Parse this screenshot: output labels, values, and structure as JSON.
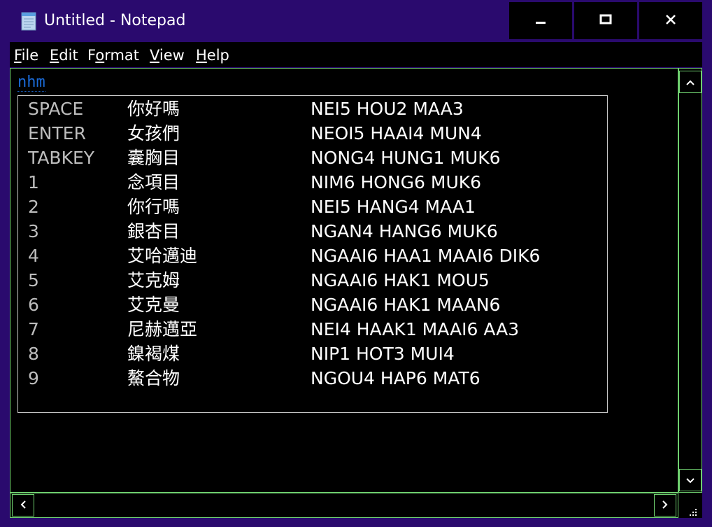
{
  "window": {
    "title": "Untitled - Notepad",
    "app_icon": "notepad-icon",
    "caption_buttons": [
      "minimize-icon",
      "maximize-icon",
      "close-icon"
    ]
  },
  "menu": {
    "items": [
      {
        "label_acc": "F",
        "label_rest": "ile"
      },
      {
        "label_acc": "E",
        "label_rest": "dit"
      },
      {
        "label_pre": "F",
        "label_acc": "o",
        "label_rest": "rmat"
      },
      {
        "label_acc": "V",
        "label_rest": "iew"
      },
      {
        "label_acc": "H",
        "label_rest": "elp"
      }
    ]
  },
  "editor": {
    "typed_text": "nhm"
  },
  "ime": {
    "candidates": [
      {
        "key": "SPACE",
        "chars": "你好嗎",
        "jyutping": "NEI5 HOU2 MAA3"
      },
      {
        "key": "ENTER",
        "chars": "女孩們",
        "jyutping": "NEOI5 HAAI4 MUN4"
      },
      {
        "key": "TABKEY",
        "chars": "囊胸目",
        "jyutping": "NONG4 HUNG1 MUK6"
      },
      {
        "key": "1",
        "chars": "念項目",
        "jyutping": "NIM6 HONG6 MUK6"
      },
      {
        "key": "2",
        "chars": "你行嗎",
        "jyutping": "NEI5 HANG4 MAA1"
      },
      {
        "key": "3",
        "chars": "銀杏目",
        "jyutping": "NGAN4 HANG6 MUK6"
      },
      {
        "key": "4",
        "chars": "艾哈邁迪",
        "jyutping": "NGAAI6 HAA1 MAAI6 DIK6"
      },
      {
        "key": "5",
        "chars": "艾克姆",
        "jyutping": "NGAAI6 HAK1 MOU5"
      },
      {
        "key": "6",
        "chars": "艾克曼",
        "jyutping": "NGAAI6 HAK1 MAAN6"
      },
      {
        "key": "7",
        "chars": "尼赫邁亞",
        "jyutping": "NEI4 HAAK1 MAAI6 AA3"
      },
      {
        "key": "8",
        "chars": "鎳褐煤",
        "jyutping": "NIP1 HOT3 MUI4"
      },
      {
        "key": "9",
        "chars": "鰲合物",
        "jyutping": "NGOU4 HAP6 MAT6"
      }
    ]
  },
  "scrollbars": {
    "up": "chevron-up-icon",
    "down": "chevron-down-icon",
    "left": "chevron-left-icon",
    "right": "chevron-right-icon",
    "grip": "size-grip-icon"
  },
  "colors": {
    "frame": "#2a0a6e",
    "background": "#000000",
    "typed_text": "#1a6ad6",
    "border_accent": "#6fcf6f"
  }
}
